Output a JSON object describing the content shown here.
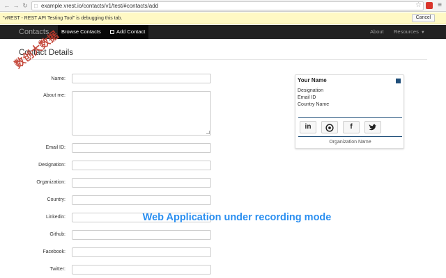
{
  "browser": {
    "back_icon": "arrow-left-icon",
    "forward_icon": "arrow-right-icon",
    "reload_icon": "reload-icon",
    "url": "example.vrest.io/contacts/v1/test/#contacts/add",
    "star_icon": "star-icon",
    "menu_icon": "menu-icon"
  },
  "infobar": {
    "message": "\"vREST - REST API Testing Tool\" is debugging this tab.",
    "cancel_label": "Cancel"
  },
  "navbar": {
    "brand": "Contacts",
    "browse_label": "Browse Contacts",
    "add_label": "Add Contact",
    "about_label": "About",
    "resources_label": "Resources"
  },
  "page": {
    "title": "Contact Details"
  },
  "form": {
    "name_label": "Name:",
    "about_label": "About me:",
    "email_label": "Email ID:",
    "designation_label": "Designation:",
    "organization_label": "Organization:",
    "country_label": "Country:",
    "linkedin_label": "Linkedin:",
    "github_label": "Github:",
    "facebook_label": "Facebook:",
    "twitter_label": "Twitter:"
  },
  "card": {
    "name": "Your Name",
    "designation": "Designation",
    "email": "Email ID",
    "country": "Country Name",
    "organization": "Organization Name",
    "linkedin_glyph": "in",
    "facebook_glyph": "f"
  },
  "overlay": {
    "watermark": "数创大数据",
    "recording_text": "Web Application under recording mode"
  },
  "colors": {
    "navbar": "#222222",
    "infobar": "#fff9c4",
    "card_accent": "#1f4e79",
    "recording_text": "#2b8ff0",
    "watermark": "#c0392b"
  }
}
